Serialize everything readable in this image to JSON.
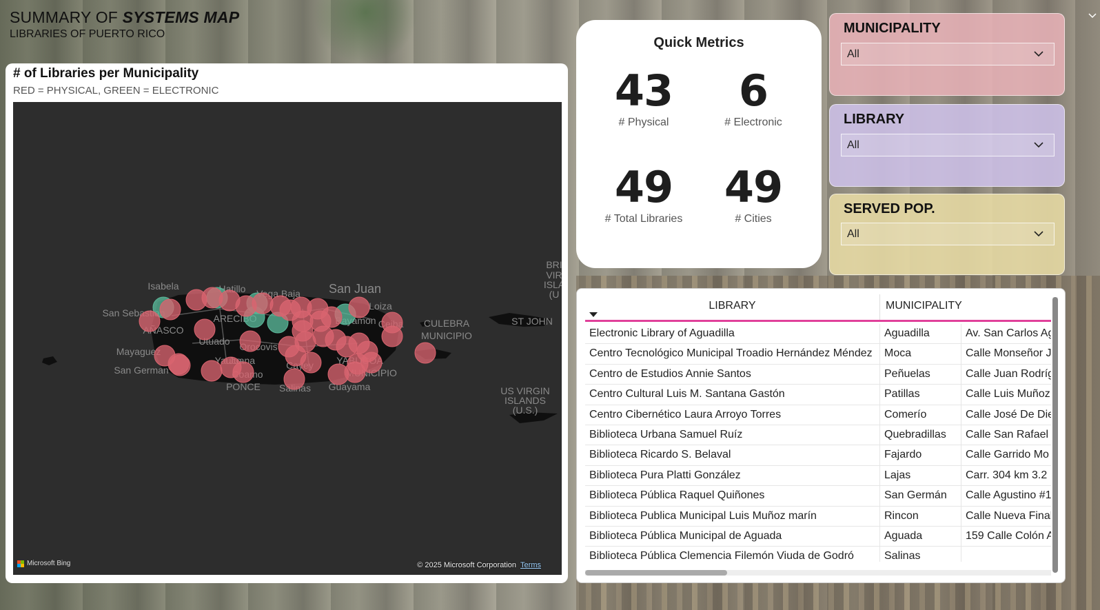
{
  "header": {
    "title_prefix": "SUMMARY OF ",
    "title_emphasis": "SYSTEMS MAP",
    "subtitle": "LIBRARIES OF PUERTO RICO"
  },
  "map": {
    "title": "# of Libraries per Municipality",
    "subtitle": "RED = PHYSICAL, GREEN = ELECTRONIC",
    "colors": {
      "physical": "#d9646f",
      "electronic": "#5ab89a",
      "land": "#0f0f0f",
      "water": "#2d2d2d"
    },
    "labels": [
      "Isabela",
      "Hatillo",
      "Vega Baja",
      "San Juan",
      "Loiza",
      "San Sebastian",
      "ARECIBO",
      "Bayamon",
      "Ceiba",
      "CULEBRA",
      "MUNICIPIO",
      "ST JOHN",
      "Utuado",
      "Orocovis",
      "AÑASCO",
      "Mayaguez",
      "Yauco",
      "Juana",
      "Cayey",
      "YABUCOA",
      "MUNICIPIO",
      "San German",
      "Coamo",
      "PONCE",
      "Salinas",
      "Guayama",
      "US VIRGIN",
      "ISLANDS",
      "(U.S.)",
      "BRI",
      "VIR",
      "ISLA",
      "(U"
    ],
    "bing_label": "Microsoft Bing",
    "copyright": "© 2025 Microsoft Corporation",
    "terms": "Terms"
  },
  "metrics": {
    "title": "Quick Metrics",
    "physical": {
      "value": "43",
      "label": "# Physical"
    },
    "electronic": {
      "value": "6",
      "label": "# Electronic"
    },
    "total": {
      "value": "49",
      "label": "# Total Libraries"
    },
    "cities": {
      "value": "49",
      "label": "# Cities"
    }
  },
  "filters": {
    "municipality": {
      "title": "MUNICIPALITY",
      "value": "All",
      "color": "#e8b2b8"
    },
    "library": {
      "title": "LIBRARY",
      "value": "All",
      "color": "#cfc2ea"
    },
    "served_pop": {
      "title": "SERVED POP.",
      "value": "All",
      "color": "#e9dca5"
    }
  },
  "table": {
    "headers": [
      "LIBRARY",
      "MUNICIPALITY"
    ],
    "rows": [
      [
        "Electronic Library of Aguadilla",
        "Aguadilla",
        "Av. San Carlos Ag"
      ],
      [
        "Centro Tecnológico Municipal Troadio Hernández Méndez",
        "Moca",
        "Calle Monseñor J"
      ],
      [
        "Centro de Estudios Annie Santos",
        "Peñuelas",
        "Calle Juan Rodríg"
      ],
      [
        "Centro Cultural Luis M. Santana Gastón",
        "Patillas",
        "Calle Luis Muñoz"
      ],
      [
        "Centro Cibernético Laura Arroyo Torres",
        "Comerío",
        "Calle José De Die"
      ],
      [
        "Biblioteca Urbana Samuel Ruíz",
        "Quebradillas",
        "Calle San Rafael E"
      ],
      [
        "Biblioteca Ricardo S. Belaval",
        "Fajardo",
        "Calle Garrido Mo"
      ],
      [
        "Biblioteca Pura Platti González",
        "Lajas",
        "Carr. 304 km 3.2"
      ],
      [
        "Biblioteca Pública Raquel Quiñones",
        "San Germán",
        "Calle Agustino #1"
      ],
      [
        "Biblioteca Publica Municipal Luis Muñoz marín",
        "Rincon",
        "Calle Nueva Final"
      ],
      [
        "Biblioteca Pública Municipal de Aguada",
        "Aguada",
        "159 Calle Colón A"
      ],
      [
        "Biblioteca Pública Clemencia Filemón Viuda de Godró",
        "Salinas",
        ""
      ]
    ]
  }
}
